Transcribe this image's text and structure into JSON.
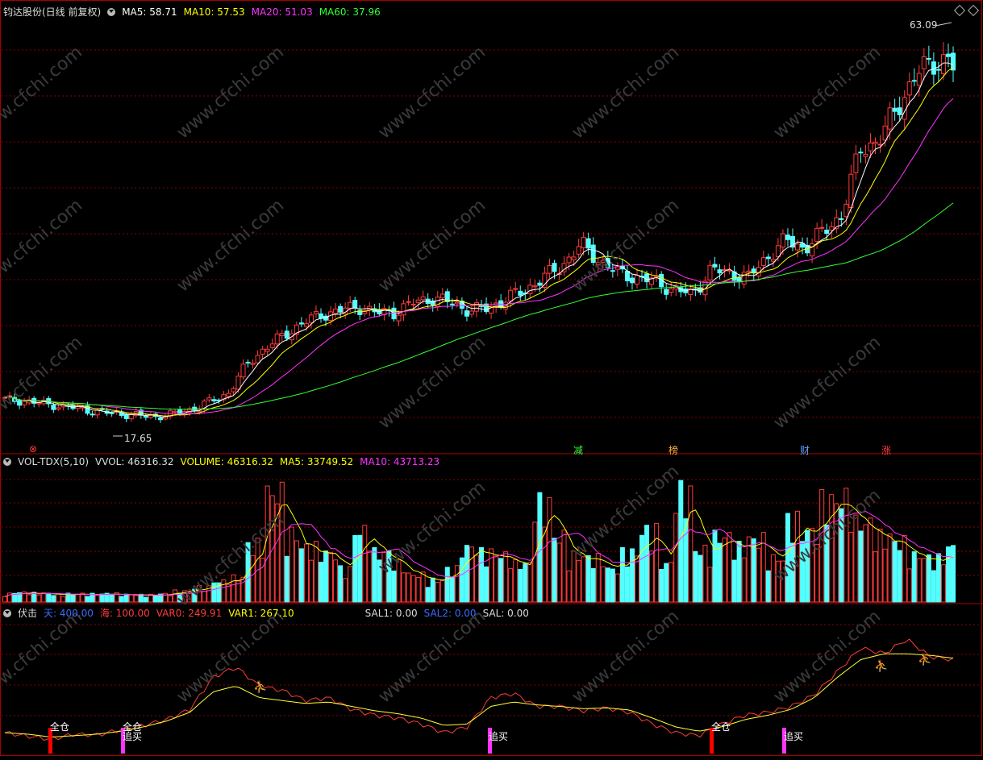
{
  "colors": {
    "up": "#ff3b3b",
    "down": "#54ffff",
    "ma5": "#ffffff",
    "ma10": "#ffff00",
    "ma20": "#ff33ff",
    "ma60": "#33ff33",
    "grid": "#8a0000",
    "border": "#aa0000"
  },
  "main_header": {
    "title": "钧达股份(日线 前复权)",
    "ma5": "MA5: 58.71",
    "ma10": "MA10: 57.53",
    "ma20": "MA20: 51.03",
    "ma60": "MA60: 37.96"
  },
  "vol_header": {
    "title": "VOL-TDX(5,10)",
    "vvol": "VVOL: 46316.32",
    "volume": "VOLUME: 46316.32",
    "ma5": "MA5: 33749.52",
    "ma10": "MA10: 43713.23"
  },
  "ind_header": {
    "title": "伏击",
    "tian": "天: 400.00",
    "hai": "海: 100.00",
    "var0": "VAR0: 249.91",
    "var1": "VAR1: 267.10",
    "sal1": "SAL1: 0.00",
    "sal2": "SAL2: 0.00",
    "sal": "SAL: 0.00"
  },
  "annotations": {
    "high": "63.09",
    "low": "17.65",
    "events": [
      "减",
      "榜",
      "财",
      "涨"
    ],
    "event_left_mark": "⊗",
    "signals": {
      "full": "全仓",
      "chase": "追买"
    }
  },
  "chart_data": [
    {
      "type": "candlestick",
      "title": "钧达股份(日线 前复权)",
      "ylim": [
        15,
        66
      ],
      "high_label": 63.09,
      "low_label": 17.65,
      "close_sample_every_5_bars": [
        19.8,
        19.6,
        19.3,
        19.0,
        18.7,
        18.3,
        18.1,
        17.9,
        17.7,
        18.0,
        18.6,
        19.5,
        20.5,
        24.0,
        26.0,
        27.5,
        29.0,
        30.0,
        30.5,
        31.0,
        30.2,
        30.3,
        31.5,
        32.0,
        31.5,
        30.5,
        30.8,
        32.0,
        33.0,
        34.5,
        36.0,
        38.5,
        36.5,
        35.0,
        34.5,
        34.0,
        33.0,
        32.5,
        35.5,
        35.0,
        34.5,
        37.0,
        39.0,
        38.0,
        40.0,
        42.0,
        50.0,
        51.0,
        55.0,
        59.0,
        60.5,
        61.0
      ],
      "ma_last": {
        "MA5": 58.71,
        "MA10": 57.53,
        "MA20": 51.03,
        "MA60": 37.96
      }
    },
    {
      "type": "bar",
      "title": "VOL-TDX(5,10)",
      "values_sample": [
        3000,
        3500,
        3200,
        2800,
        3000,
        2900,
        3100,
        2700,
        2600,
        3000,
        4000,
        5500,
        7500,
        9000,
        21000,
        40000,
        25000,
        20000,
        18000,
        12000,
        26000,
        18000,
        14000,
        10000,
        8000,
        12000,
        20000,
        18000,
        17000,
        14000,
        36000,
        24000,
        17000,
        16000,
        12000,
        18000,
        26000,
        14000,
        40000,
        19000,
        24000,
        20000,
        23000,
        16000,
        30000,
        26000,
        37000,
        38000,
        29000,
        24000,
        22000,
        17000,
        16000,
        20000
      ],
      "ma_last": {
        "VOLUME": 46316.32,
        "MA5": 33749.52,
        "MA10": 43713.23
      },
      "ylim": [
        0,
        52000
      ]
    },
    {
      "type": "line",
      "title": "伏击",
      "series": [
        {
          "name": "VAR0",
          "values": [
            30,
            18,
            8,
            25,
            22,
            40,
            55,
            75,
            110,
            220,
            255,
            190,
            175,
            140,
            150,
            110,
            90,
            80,
            60,
            30,
            50,
            150,
            165,
            120,
            120,
            105,
            115,
            100,
            60,
            30,
            20,
            60,
            90,
            100,
            120,
            160,
            240,
            320,
            300,
            350,
            290,
            280
          ]
        },
        {
          "name": "VAR1",
          "values": [
            30,
            25,
            15,
            20,
            25,
            35,
            50,
            70,
            100,
            170,
            190,
            150,
            140,
            130,
            135,
            120,
            105,
            95,
            80,
            55,
            60,
            120,
            135,
            125,
            120,
            112,
            115,
            108,
            80,
            50,
            35,
            50,
            75,
            90,
            110,
            150,
            220,
            280,
            300,
            300,
            295,
            285
          ]
        }
      ],
      "ylim": [
        0,
        400
      ],
      "signals": [
        {
          "label": "全仓",
          "x_index": 1
        },
        {
          "label": "全仓",
          "x_index": 26
        },
        {
          "label": "追买",
          "x_index": 27
        },
        {
          "label": "追买",
          "x_index": 58
        },
        {
          "label": "全仓",
          "x_index": 160
        },
        {
          "label": "追买",
          "x_index": 175
        }
      ]
    }
  ]
}
